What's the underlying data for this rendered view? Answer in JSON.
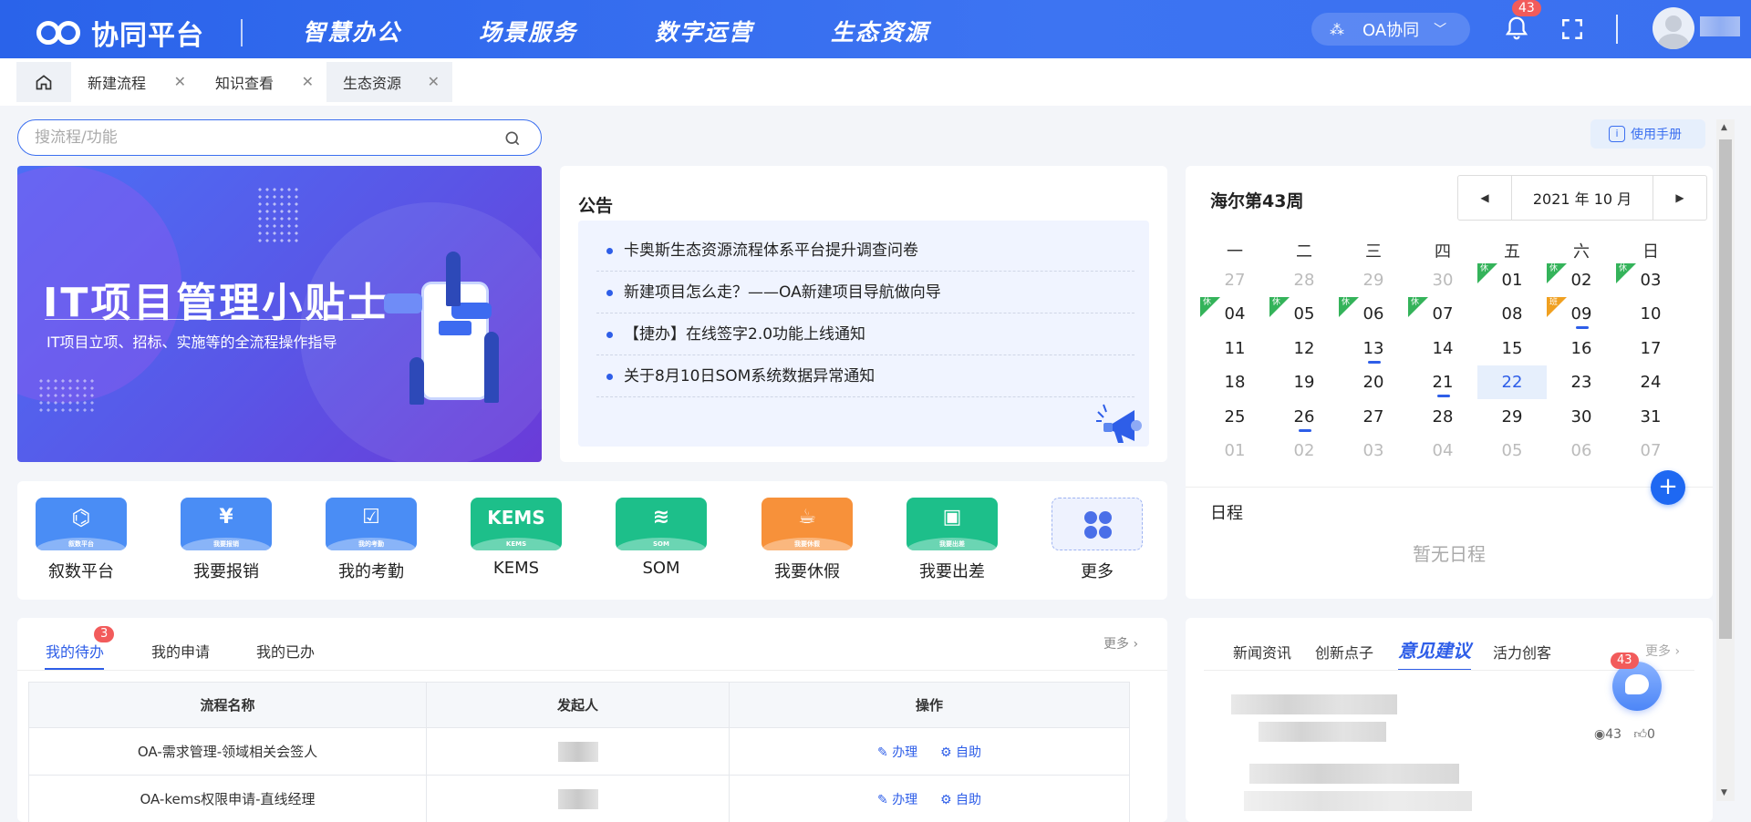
{
  "header": {
    "brand": "协同平台",
    "nav": [
      "智慧办公",
      "场景服务",
      "数字运营",
      "生态资源"
    ],
    "system_switch": "OA协同",
    "notifications_count": "43"
  },
  "tabs": {
    "home_icon": "home-icon",
    "items": [
      {
        "label": "新建流程"
      },
      {
        "label": "知识查看"
      },
      {
        "label": "生态资源",
        "active": true
      }
    ]
  },
  "search": {
    "placeholder": "搜流程/功能"
  },
  "manual_button": "使用手册",
  "banner": {
    "title": "IT项目管理小贴士",
    "subtitle": "IT项目立项、招标、实施等的全流程操作指导"
  },
  "notice": {
    "title": "公告",
    "items": [
      "卡奥斯生态资源流程体系平台提升调查问卷",
      "新建项目怎么走？——OA新建项目导航做向导",
      "【捷办】在线签字2.0功能上线通知",
      "关于8月10日SOM系统数据异常通知"
    ]
  },
  "calendar": {
    "title": "海尔第43周",
    "month_label": "2021 年 10 月",
    "weekdays": [
      "一",
      "二",
      "三",
      "四",
      "五",
      "六",
      "日"
    ],
    "rows": [
      [
        "27",
        "28",
        "29",
        "30",
        "01",
        "02",
        "03"
      ],
      [
        "04",
        "05",
        "06",
        "07",
        "08",
        "09",
        "10"
      ],
      [
        "11",
        "12",
        "13",
        "14",
        "15",
        "16",
        "17"
      ],
      [
        "18",
        "19",
        "20",
        "21",
        "22",
        "23",
        "24"
      ],
      [
        "25",
        "26",
        "27",
        "28",
        "29",
        "30",
        "31"
      ],
      [
        "01",
        "02",
        "03",
        "04",
        "05",
        "06",
        "07"
      ]
    ],
    "selected": "22",
    "holiday_flag": "休",
    "workday_flag": "班",
    "schedule_title": "日程",
    "schedule_empty": "暂无日程"
  },
  "apps": [
    {
      "label": "叙数平台",
      "band": "叙数平台",
      "color": "#4a8df5",
      "icon": "network-icon"
    },
    {
      "label": "我要报销",
      "band": "我要报销",
      "color": "#4a8df5",
      "icon": "yuan-icon"
    },
    {
      "label": "我的考勤",
      "band": "我的考勤",
      "color": "#4a8df5",
      "icon": "calendar-check-icon"
    },
    {
      "label": "KEMS",
      "band": "KEMS",
      "color": "#1dbf8a",
      "icon": "kems-icon",
      "glyph": "KEMS"
    },
    {
      "label": "SOM",
      "band": "SOM",
      "color": "#1dbf8a",
      "icon": "layers-icon"
    },
    {
      "label": "我要休假",
      "band": "我要休假",
      "color": "#f7913a",
      "icon": "coffee-icon"
    },
    {
      "label": "我要出差",
      "band": "我要出差",
      "color": "#1dbf8a",
      "icon": "suitcase-icon"
    },
    {
      "label": "更多",
      "color": "#eef2fe",
      "icon": "clover-icon"
    }
  ],
  "todo": {
    "tabs": [
      "我的待办",
      "我的申请",
      "我的已办"
    ],
    "badge": "3",
    "more": "更多",
    "columns": [
      "流程名称",
      "发起人",
      "操作"
    ],
    "rows": [
      {
        "name": "OA-需求管理-领域相关会签人",
        "actions": [
          "办理",
          "自助"
        ]
      },
      {
        "name": "OA-kems权限申请-直线经理",
        "actions": [
          "办理",
          "自助"
        ]
      }
    ]
  },
  "news": {
    "tabs": [
      "新闻资讯",
      "创新点子",
      "意见建议",
      "活力创客"
    ],
    "active": "意见建议",
    "more": "更多",
    "views": "43",
    "likes": "0",
    "chatbot_badge": "43"
  }
}
